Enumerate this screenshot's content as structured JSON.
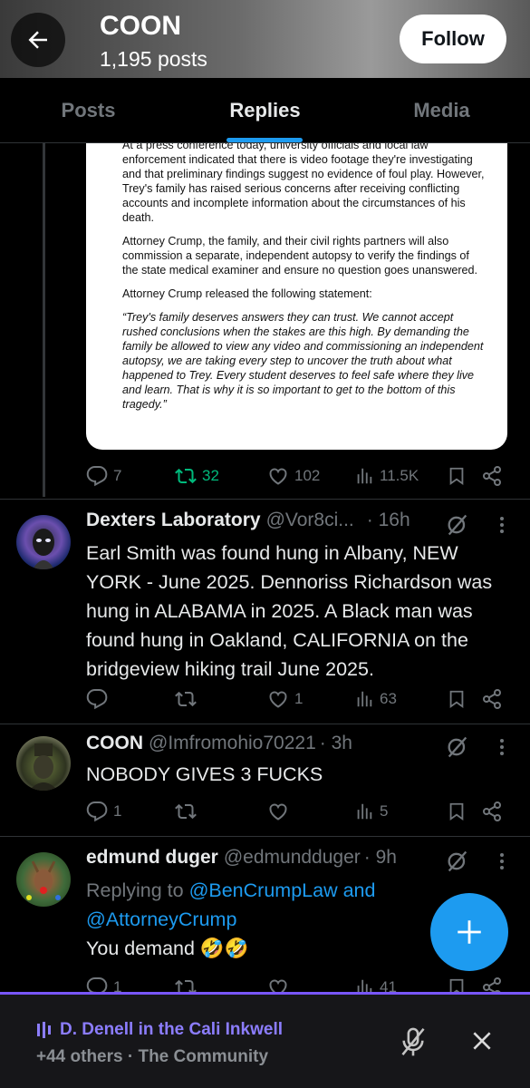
{
  "header": {
    "title": "COON",
    "posts_count": "1,195 posts",
    "follow_label": "Follow"
  },
  "tabs": [
    {
      "label": "Posts",
      "active": false
    },
    {
      "label": "Replies",
      "active": true
    },
    {
      "label": "Media",
      "active": false
    }
  ],
  "document": {
    "paragraphs": [
      "At a press conference today, university officials and local law enforcement indicated that there is video footage they're investigating and that preliminary findings suggest no evidence of foul play. However, Trey's family has raised serious concerns after receiving conflicting accounts and incomplete information about the circumstances of his death.",
      "Attorney Crump, the family, and their civil rights partners will also commission a separate, independent autopsy to verify the findings of the state medical examiner and ensure no question goes unanswered.",
      "Attorney Crump released the following statement:",
      "“Trey's family deserves answers they can trust. We cannot accept rushed conclusions when the stakes are this high. By demanding the family be allowed to view any video and commissioning an independent autopsy, we are taking every step to uncover the truth about what happened to Trey. Every student deserves to feel safe where they live and learn. That is why it is so important to get to the bottom of this tragedy.”"
    ]
  },
  "top_post_stats": {
    "replies": "7",
    "reposts": "32",
    "likes": "102",
    "views": "11.5K"
  },
  "replies": [
    {
      "name": "Dexters Laboratory",
      "handle": "@Vor8ci...",
      "time": "· 16h",
      "text": "Earl Smith was found hung in Albany, NEW YORK - June 2025. Dennoriss Richardson was hung in ALABAMA in 2025. A Black man was found hung in Oakland, CALIFORNIA on the bridgeview hiking trail June 2025.",
      "replies": "",
      "reposts": "",
      "likes": "1",
      "views": "63"
    },
    {
      "name": "COON",
      "handle": "@Imfromohio70221",
      "time": "· 3h",
      "text": "NOBODY GIVES 3 FUCKS",
      "replies": "1",
      "reposts": "",
      "likes": "",
      "views": "5"
    },
    {
      "name": "edmund duger",
      "handle": "@edmundduger",
      "time": "· 9h",
      "replying_prefix": "Replying to",
      "replying_mentions": "@BenCrumpLaw and @AttorneyCrump",
      "text": "You demand 🤣🤣",
      "replies": "1",
      "reposts": "",
      "likes": "",
      "views": "41"
    }
  ],
  "space_bar": {
    "title": "D. Denell in the Cali Inkwell",
    "subtitle": "+44 others · The Community"
  },
  "colors": {
    "accent": "#1d9bf0",
    "repost_green": "#00ba7c",
    "space_purple": "#7856ff"
  }
}
